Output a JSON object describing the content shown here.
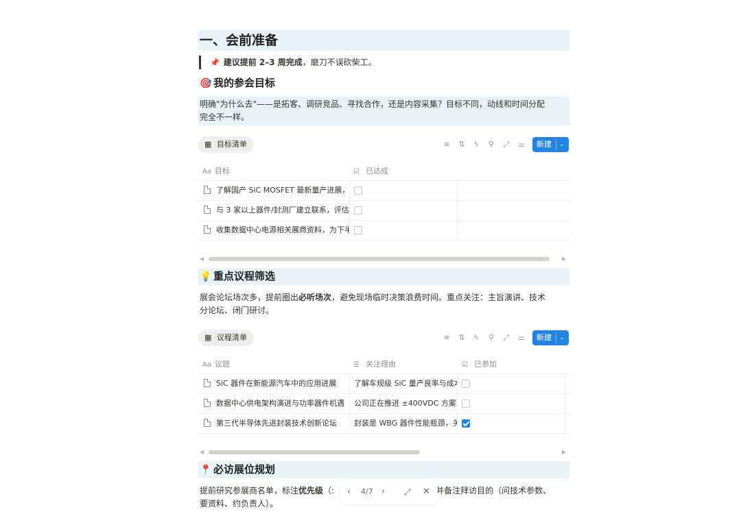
{
  "section1": {
    "title": "一、会前准备",
    "quote_icon": "📌",
    "quote_bold": "建议提前 2–3 周完成",
    "quote_rest": "，磨刀不误砍柴工。"
  },
  "goals": {
    "heading_icon": "🎯",
    "heading": "我的参会目标",
    "para_line1": "明确\"为什么去\"——是拓客、调研竞品、寻找合作，还是内容采集？目标不同，动线和时间分配",
    "para_line2": "完全不一样。",
    "view_name": "目标清单",
    "new_label": "新建",
    "col_title": "目标",
    "col_done": "已达成",
    "rows": [
      {
        "title": "了解国产 SiC MOSFET 最新量产进展，重",
        "done": false
      },
      {
        "title": "与 3 家以上器件/封测厂建立联系，评估(",
        "done": false
      },
      {
        "title": "收集数据中心电源相关展商资料，为下半",
        "done": false
      }
    ]
  },
  "agenda": {
    "heading_icon": "💡",
    "heading": "重点议程筛选",
    "para_pre": "展会论坛场次多，提前圈出",
    "para_bold": "必听场次",
    "para_post": "，避免现场临时决策浪费时间。重点关注：主旨演讲、技术",
    "para_line2": "分论坛、闭门研讨。",
    "view_name": "议程清单",
    "new_label": "新建",
    "col_title": "议题",
    "col_reason": "关注理由",
    "col_attend": "已参加",
    "rows": [
      {
        "title": "SiC 器件在新能源汽车中的应用进展",
        "reason": "了解车规级 SiC 量产良率与成本",
        "attended": false
      },
      {
        "title": "数据中心供电架构演进与功率器件机遇",
        "reason": "公司正在推进 ±400VDC 方案落",
        "attended": false
      },
      {
        "title": "第三代半导体先进封装技术创新论坛",
        "reason": "封装是 WBG 器件性能瓶颈，关",
        "attended": true
      }
    ]
  },
  "booths": {
    "heading_icon": "📍",
    "heading": "必访展位规划",
    "para_pre": "提前研究参展商名单，标注",
    "para_bold": "优先级",
    "para_mid": "（:",
    "para_post": "并备注拜访目的（问技术参数、",
    "para_line2": "要资料、约负责人）。"
  },
  "pager": {
    "page": "4/7"
  }
}
